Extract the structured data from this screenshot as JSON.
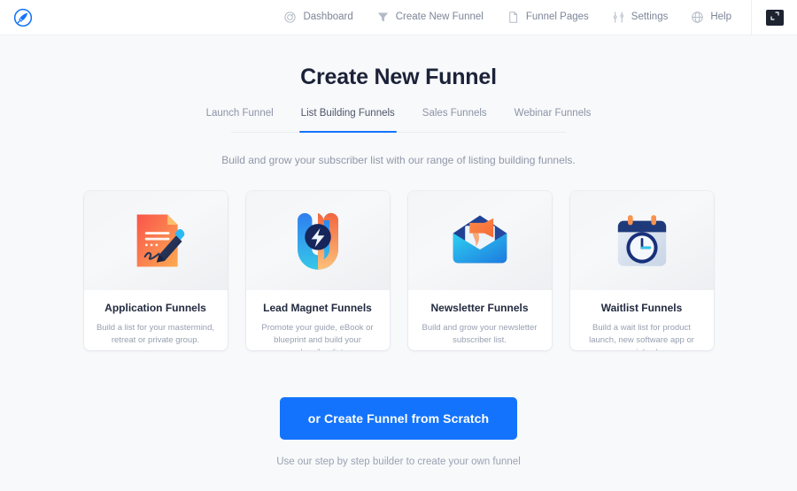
{
  "topbar": {
    "logo_icon": "rocket-circle-logo",
    "nav_items": [
      {
        "label": "Dashboard",
        "icon": "speedometer-icon"
      },
      {
        "label": "Create New Funnel",
        "icon": "funnel-icon"
      },
      {
        "label": "Funnel Pages",
        "icon": "page-icon"
      },
      {
        "label": "Settings",
        "icon": "sliders-icon"
      },
      {
        "label": "Help",
        "icon": "lifebuoy-icon"
      }
    ],
    "fullscreen_icon": "fullscreen-expand-icon",
    "fullscreen_label": "Fullscreen"
  },
  "page": {
    "title": "Create New Funnel",
    "subtitle": "Build and grow your subscriber list with our range of listing building funnels.",
    "tabs": [
      {
        "label": "Launch Funnel",
        "active": false
      },
      {
        "label": "List Building Funnels",
        "active": true
      },
      {
        "label": "Sales Funnels",
        "active": false
      },
      {
        "label": "Webinar Funnels",
        "active": false
      }
    ],
    "cards": [
      {
        "title": "Application Funnels",
        "desc": "Build a list for your mastermind, retreat or private group.",
        "icon": "document-with-pen-icon"
      },
      {
        "title": "Lead Magnet Funnels",
        "desc": "Promote your guide, eBook or blueprint and build your subscriber list",
        "icon": "magnet-with-bolt-icon"
      },
      {
        "title": "Newsletter Funnels",
        "desc": "Build and grow your newsletter subscriber list.",
        "icon": "envelope-with-megaphone-icon"
      },
      {
        "title": "Waitlist Funnels",
        "desc": "Build a wait list for product launch, new software app or special sale.",
        "icon": "calendar-with-clock-icon"
      }
    ],
    "cta_button": "or Create Funnel from Scratch",
    "cta_note": "Use our step by step builder to create your own funnel"
  },
  "colors": {
    "accent_blue": "#1473fc",
    "background": "#f8f9fb",
    "title_navy": "#1b2238",
    "muted_text": "#8f97a8"
  }
}
